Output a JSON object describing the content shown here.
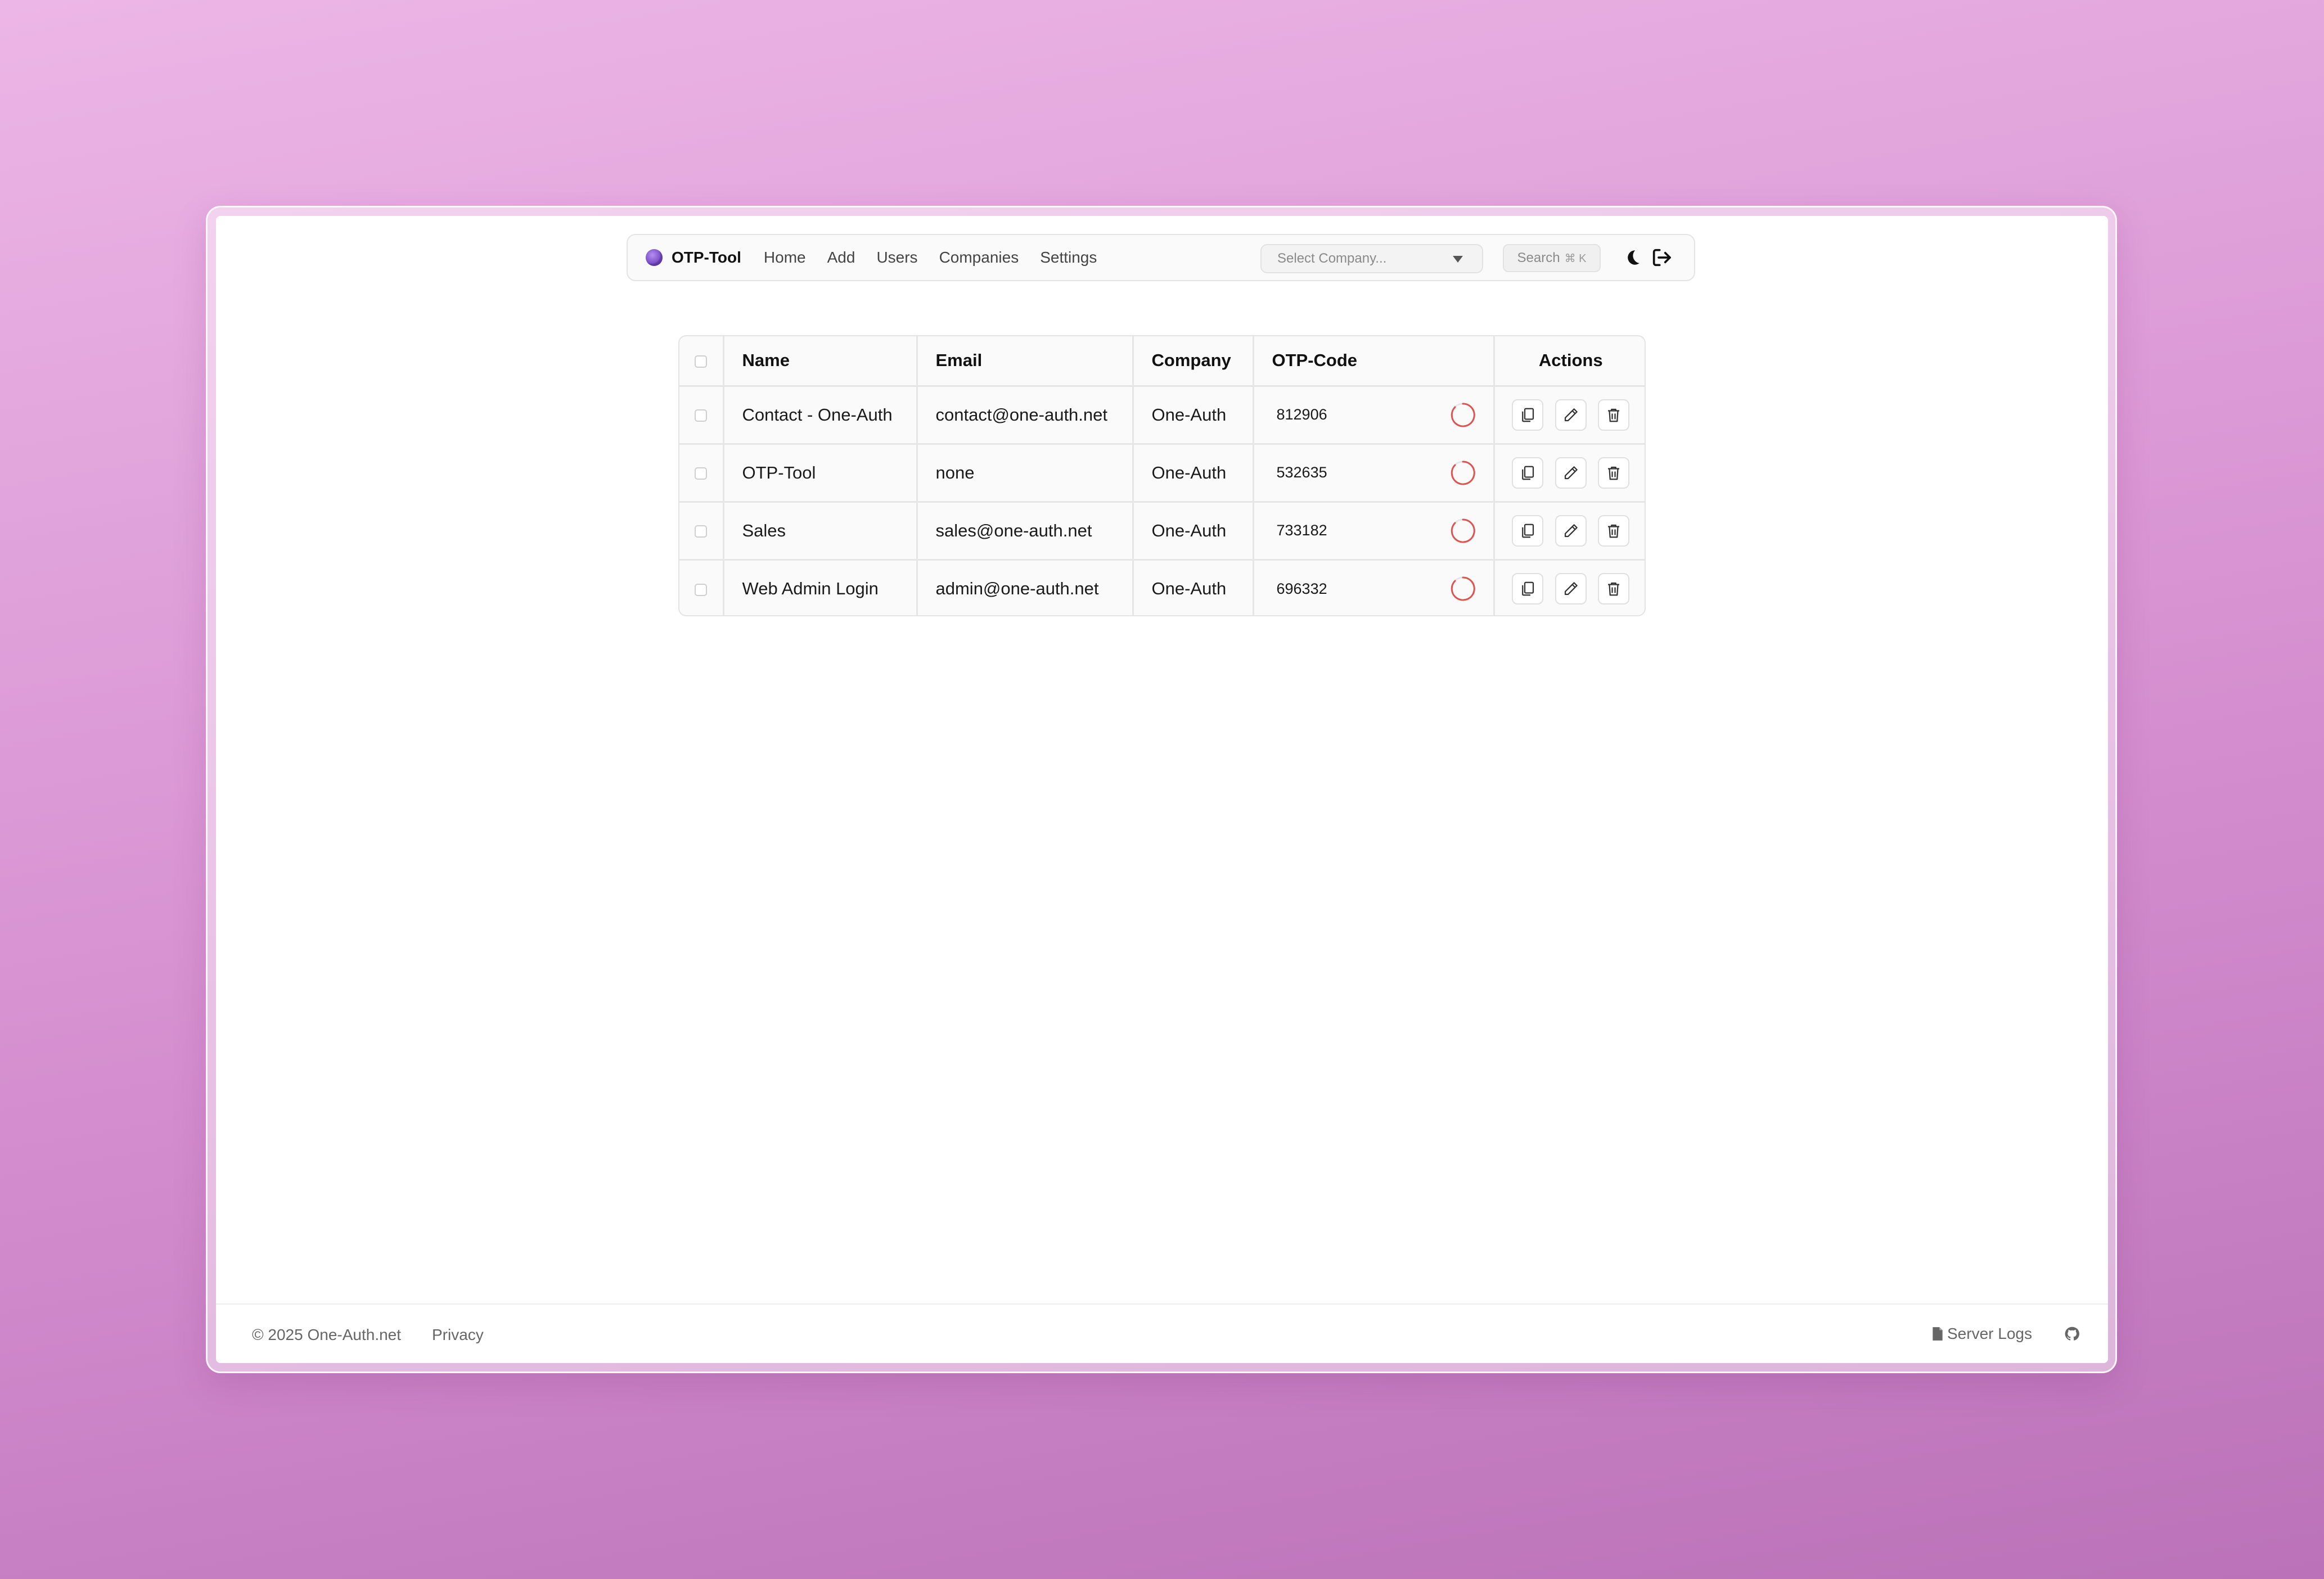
{
  "navbar": {
    "brand": "OTP-Tool",
    "links": [
      "Home",
      "Add",
      "Users",
      "Companies",
      "Settings"
    ],
    "company_select_placeholder": "Select Company...",
    "search_label": "Search",
    "search_shortcut": "⌘ K",
    "icons": [
      "logo-icon",
      "moon-icon",
      "logout-icon"
    ]
  },
  "table": {
    "headers": [
      "Name",
      "Email",
      "Company",
      "OTP-Code",
      "Actions"
    ],
    "rows": [
      {
        "name": "Contact - One-Auth",
        "email": "contact@one-auth.net",
        "company": "One-Auth",
        "otp": "812906"
      },
      {
        "name": "OTP-Tool",
        "email": "none",
        "company": "One-Auth",
        "otp": "532635"
      },
      {
        "name": "Sales",
        "email": "sales@one-auth.net",
        "company": "One-Auth",
        "otp": "733182"
      },
      {
        "name": "Web Admin Login",
        "email": "admin@one-auth.net",
        "company": "One-Auth",
        "otp": "696332"
      }
    ],
    "row_action_icons": [
      "copy-icon",
      "edit-icon",
      "trash-icon"
    ],
    "timer_color": "#e0524f"
  },
  "footer": {
    "copyright": "© 2025 One-Auth.net",
    "privacy": "Privacy",
    "server_logs": "Server Logs",
    "icons": [
      "file-icon",
      "github-icon"
    ]
  },
  "colors": {
    "background_top": "#ecb6e6",
    "background_bottom": "#bb72b8",
    "brand_logo": "#6c3fc0"
  }
}
